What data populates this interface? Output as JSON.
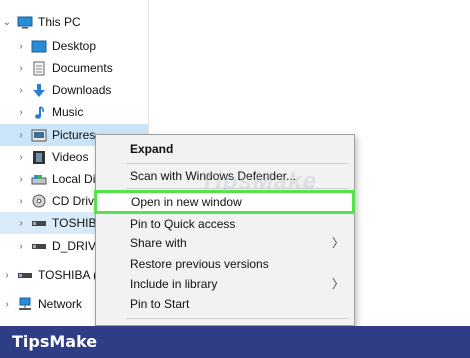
{
  "tree": {
    "root_label": "This PC",
    "items": [
      {
        "label": "Desktop",
        "icon": "desktop-folder-icon"
      },
      {
        "label": "Documents",
        "icon": "documents-folder-icon"
      },
      {
        "label": "Downloads",
        "icon": "downloads-folder-icon"
      },
      {
        "label": "Music",
        "icon": "music-folder-icon"
      },
      {
        "label": "Pictures",
        "icon": "pictures-folder-icon"
      },
      {
        "label": "Videos",
        "icon": "videos-folder-icon"
      },
      {
        "label": "Local Disk",
        "icon": "local-disk-icon"
      },
      {
        "label": "CD Drive",
        "icon": "cd-drive-icon"
      },
      {
        "label": "TOSHIBA",
        "icon": "usb-drive-icon"
      },
      {
        "label": "D_DRIVE",
        "icon": "drive-icon"
      }
    ],
    "toshiba2_label": "TOSHIBA (",
    "network_label": "Network"
  },
  "menu": {
    "expand": "Expand",
    "scan": "Scan with Windows Defender...",
    "open_new_window": "Open in new window",
    "pin_quick": "Pin to Quick access",
    "share_with": "Share with",
    "restore": "Restore previous versions",
    "include_library": "Include in library",
    "pin_start": "Pin to Start",
    "arrow": "〉"
  },
  "watermark": {
    "main": "TipsMake",
    "sub": ".com"
  },
  "footer": {
    "brand": "TipsMake"
  },
  "colors": {
    "highlight_border": "#56e34a",
    "footer_bg": "#2f3d86",
    "selected_bg": "#cce4f7"
  }
}
